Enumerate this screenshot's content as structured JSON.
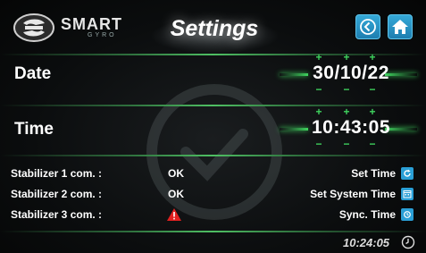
{
  "header": {
    "brand": "SMART",
    "brand_sub": "GYRO",
    "title": "Settings",
    "back_icon": "chevron-left-circle-icon",
    "home_icon": "home-icon"
  },
  "date": {
    "label": "Date",
    "value": "30/10/22"
  },
  "time": {
    "label": "Time",
    "value": "10:43:05"
  },
  "status": [
    {
      "label": "Stabilizer 1 com. :",
      "value": "OK"
    },
    {
      "label": "Stabilizer 2  com. :",
      "value": "OK"
    },
    {
      "label": "Stabilizer 3  com. :",
      "value": "",
      "icon": "warning-icon"
    }
  ],
  "actions": [
    {
      "label": "Set Time",
      "icon": "refresh-icon"
    },
    {
      "label": "Set System Time",
      "icon": "calendar-icon"
    },
    {
      "label": "Sync. Time",
      "icon": "sync-icon"
    }
  ],
  "footer": {
    "clock_time": "10:24:05",
    "clock_icon": "clock-icon"
  },
  "colors": {
    "accent_green": "#3fd45e",
    "button_blue": "#2a9fd6",
    "warning_red": "#e02020"
  }
}
